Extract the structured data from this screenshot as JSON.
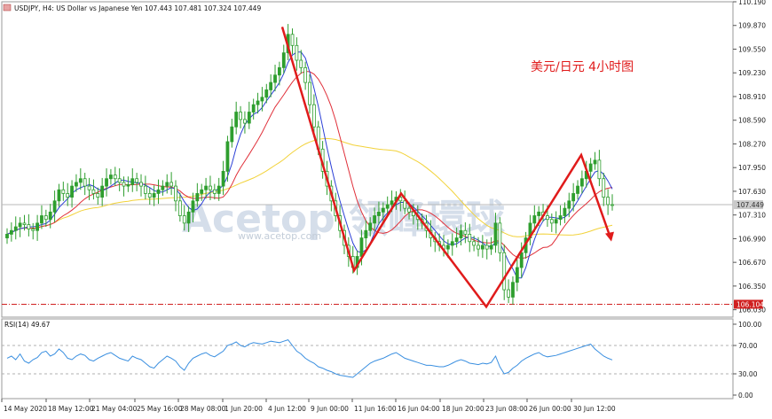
{
  "header": {
    "symbol_line": "USDJPY, H4:  US Dollar vs Japanese Yen  107.443 107.481 107.324 107.449"
  },
  "annotation": {
    "title": "美元/日元 4小时图",
    "watermark_main": "Acetop 领峰環球",
    "watermark_url": "www.acetop.com"
  },
  "colors": {
    "bull": "#2e9e2e",
    "bear": "#2e9e2e",
    "ma_fast": "#2b3fd6",
    "ma_mid": "#e0303a",
    "ma_slow": "#f2d23a",
    "pattern": "#e01b1b",
    "rsi": "#3a8fe0",
    "support": "#d02020"
  },
  "indicator": {
    "label": "RSI(14) 49.67",
    "levels": [
      100.0,
      70.0,
      30.0,
      0.0
    ],
    "level_labels": [
      "100.00",
      "70.00",
      "30.00",
      "0.00"
    ]
  },
  "chart_data": {
    "type": "candlestick",
    "title": "USDJPY, H4: US Dollar vs Japanese Yen",
    "price_ticks": [
      "110.190",
      "109.870",
      "109.550",
      "109.230",
      "108.910",
      "108.590",
      "108.270",
      "107.950",
      "107.630",
      "107.310",
      "106.990",
      "106.670",
      "106.350",
      "106.030"
    ],
    "ylim": [
      105.93,
      110.19
    ],
    "current_price": "107.449",
    "support_level": "106.104",
    "x_tick_labels": [
      "14 May 2020",
      "18 May 12:00",
      "21 May 04:00",
      "25 May 16:00",
      "28 May 08:00",
      "1 Jun 20:00",
      "4 Jun 12:00",
      "9 Jun 00:00",
      "11 Jun 16:00",
      "16 Jun 04:00",
      "18 Jun 20:00",
      "23 Jun 08:00",
      "26 Jun 00:00",
      "30 Jun 12:00"
    ],
    "pattern_points": [
      {
        "x": "4 Jun 12:00",
        "y": 109.85
      },
      {
        "x": "11 Jun 16:00",
        "y": 106.56
      },
      {
        "x": "16 Jun 04:00",
        "y": 107.6
      },
      {
        "x": "23 Jun 08:00",
        "y": 106.07
      },
      {
        "x": "30 Jun 12:00",
        "y": 108.12
      },
      {
        "x": "30 Jun 12:00",
        "y": 107.0
      }
    ],
    "close": [
      107.05,
      107.1,
      107.15,
      107.2,
      107.18,
      107.12,
      107.1,
      107.2,
      107.3,
      107.25,
      107.35,
      107.5,
      107.65,
      107.6,
      107.55,
      107.7,
      107.75,
      107.8,
      107.7,
      107.65,
      107.6,
      107.55,
      107.7,
      107.8,
      107.85,
      107.8,
      107.75,
      107.7,
      107.72,
      107.8,
      107.75,
      107.7,
      107.6,
      107.55,
      107.6,
      107.65,
      107.7,
      107.75,
      107.7,
      107.5,
      107.3,
      107.2,
      107.35,
      107.5,
      107.6,
      107.65,
      107.7,
      107.65,
      107.6,
      107.7,
      107.9,
      108.3,
      108.5,
      108.7,
      108.6,
      108.55,
      108.7,
      108.8,
      108.85,
      108.9,
      109.0,
      109.1,
      109.2,
      109.3,
      109.5,
      109.75,
      109.6,
      109.4,
      109.3,
      109.1,
      108.8,
      108.5,
      108.2,
      107.9,
      107.7,
      107.5,
      107.3,
      107.1,
      106.9,
      106.75,
      106.6,
      106.75,
      107.0,
      107.1,
      107.2,
      107.3,
      107.35,
      107.4,
      107.45,
      107.5,
      107.55,
      107.5,
      107.4,
      107.35,
      107.3,
      107.25,
      107.2,
      107.1,
      107.0,
      106.95,
      106.9,
      106.85,
      106.9,
      106.95,
      107.0,
      107.1,
      107.05,
      106.95,
      106.9,
      106.85,
      106.9,
      106.85,
      106.9,
      107.2,
      106.8,
      106.3,
      106.2,
      106.4,
      106.6,
      106.8,
      107.0,
      107.2,
      107.3,
      107.35,
      107.3,
      107.25,
      107.2,
      107.25,
      107.3,
      107.4,
      107.5,
      107.6,
      107.7,
      107.8,
      107.9,
      108.0,
      108.05,
      107.8,
      107.55,
      107.45,
      107.449
    ],
    "rsi_values": [
      52,
      55,
      50,
      58,
      48,
      45,
      50,
      53,
      60,
      62,
      55,
      58,
      65,
      60,
      52,
      50,
      55,
      58,
      56,
      50,
      48,
      52,
      55,
      58,
      60,
      56,
      52,
      50,
      48,
      55,
      52,
      50,
      45,
      40,
      38,
      45,
      50,
      55,
      52,
      48,
      40,
      35,
      45,
      52,
      55,
      58,
      60,
      56,
      54,
      58,
      62,
      70,
      72,
      75,
      70,
      68,
      72,
      74,
      73,
      72,
      74,
      76,
      75,
      74,
      76,
      78,
      70,
      62,
      58,
      52,
      48,
      45,
      40,
      38,
      35,
      33,
      30,
      28,
      27,
      26,
      25,
      30,
      35,
      40,
      45,
      48,
      50,
      52,
      55,
      58,
      60,
      56,
      52,
      50,
      48,
      46,
      44,
      42,
      42,
      41,
      40,
      40,
      42,
      45,
      48,
      50,
      48,
      45,
      44,
      43,
      45,
      44,
      46,
      55,
      40,
      30,
      32,
      38,
      42,
      48,
      52,
      55,
      58,
      60,
      56,
      54,
      55,
      56,
      58,
      60,
      62,
      64,
      66,
      68,
      70,
      72,
      65,
      60,
      55,
      52,
      49.67
    ]
  }
}
